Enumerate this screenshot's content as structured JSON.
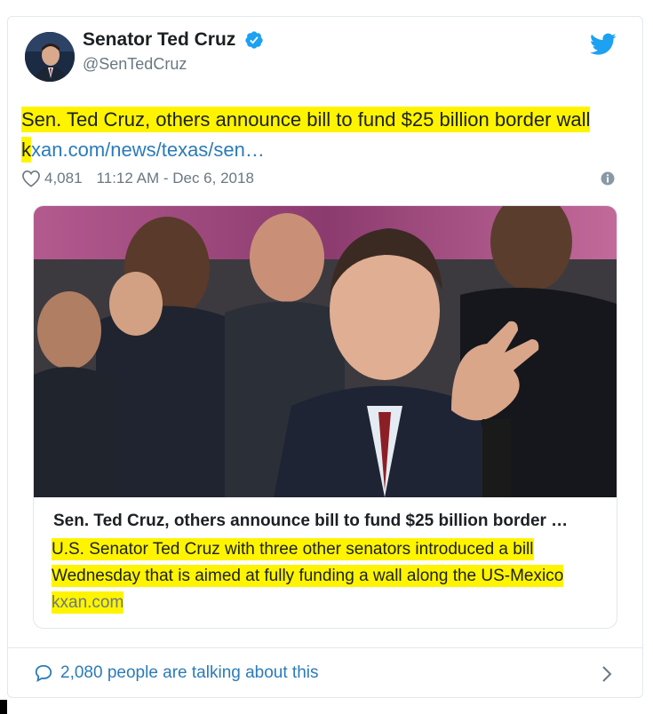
{
  "author": {
    "name": "Senator Ted Cruz",
    "handle": "@SenTedCruz"
  },
  "tweet": {
    "text": "Sen. Ted Cruz, others announce bill to fund $25 billion border wall k",
    "link_text": "xan.com/news/texas/sen…",
    "likes": "4,081",
    "timestamp": "11:12 AM - Dec 6, 2018"
  },
  "link_card": {
    "title": "Sen. Ted Cruz, others announce bill to fund $25 billion border …",
    "description": "U.S. Senator Ted Cruz with three other senators introduced a bill Wednesday that is aimed at fully funding a wall along the US-Mexico",
    "domain": "kxan.com"
  },
  "footer": {
    "talking_text": "2,080 people are talking about this"
  },
  "colors": {
    "link": "#2b7bb9",
    "highlight": "#fff400",
    "verified": "#1da1f2",
    "twitter_blue": "#1da1f2",
    "muted": "#697882"
  },
  "icons": [
    "verified-badge-icon",
    "twitter-bird-icon",
    "heart-icon",
    "info-icon",
    "speech-bubble-icon",
    "chevron-right-icon"
  ]
}
